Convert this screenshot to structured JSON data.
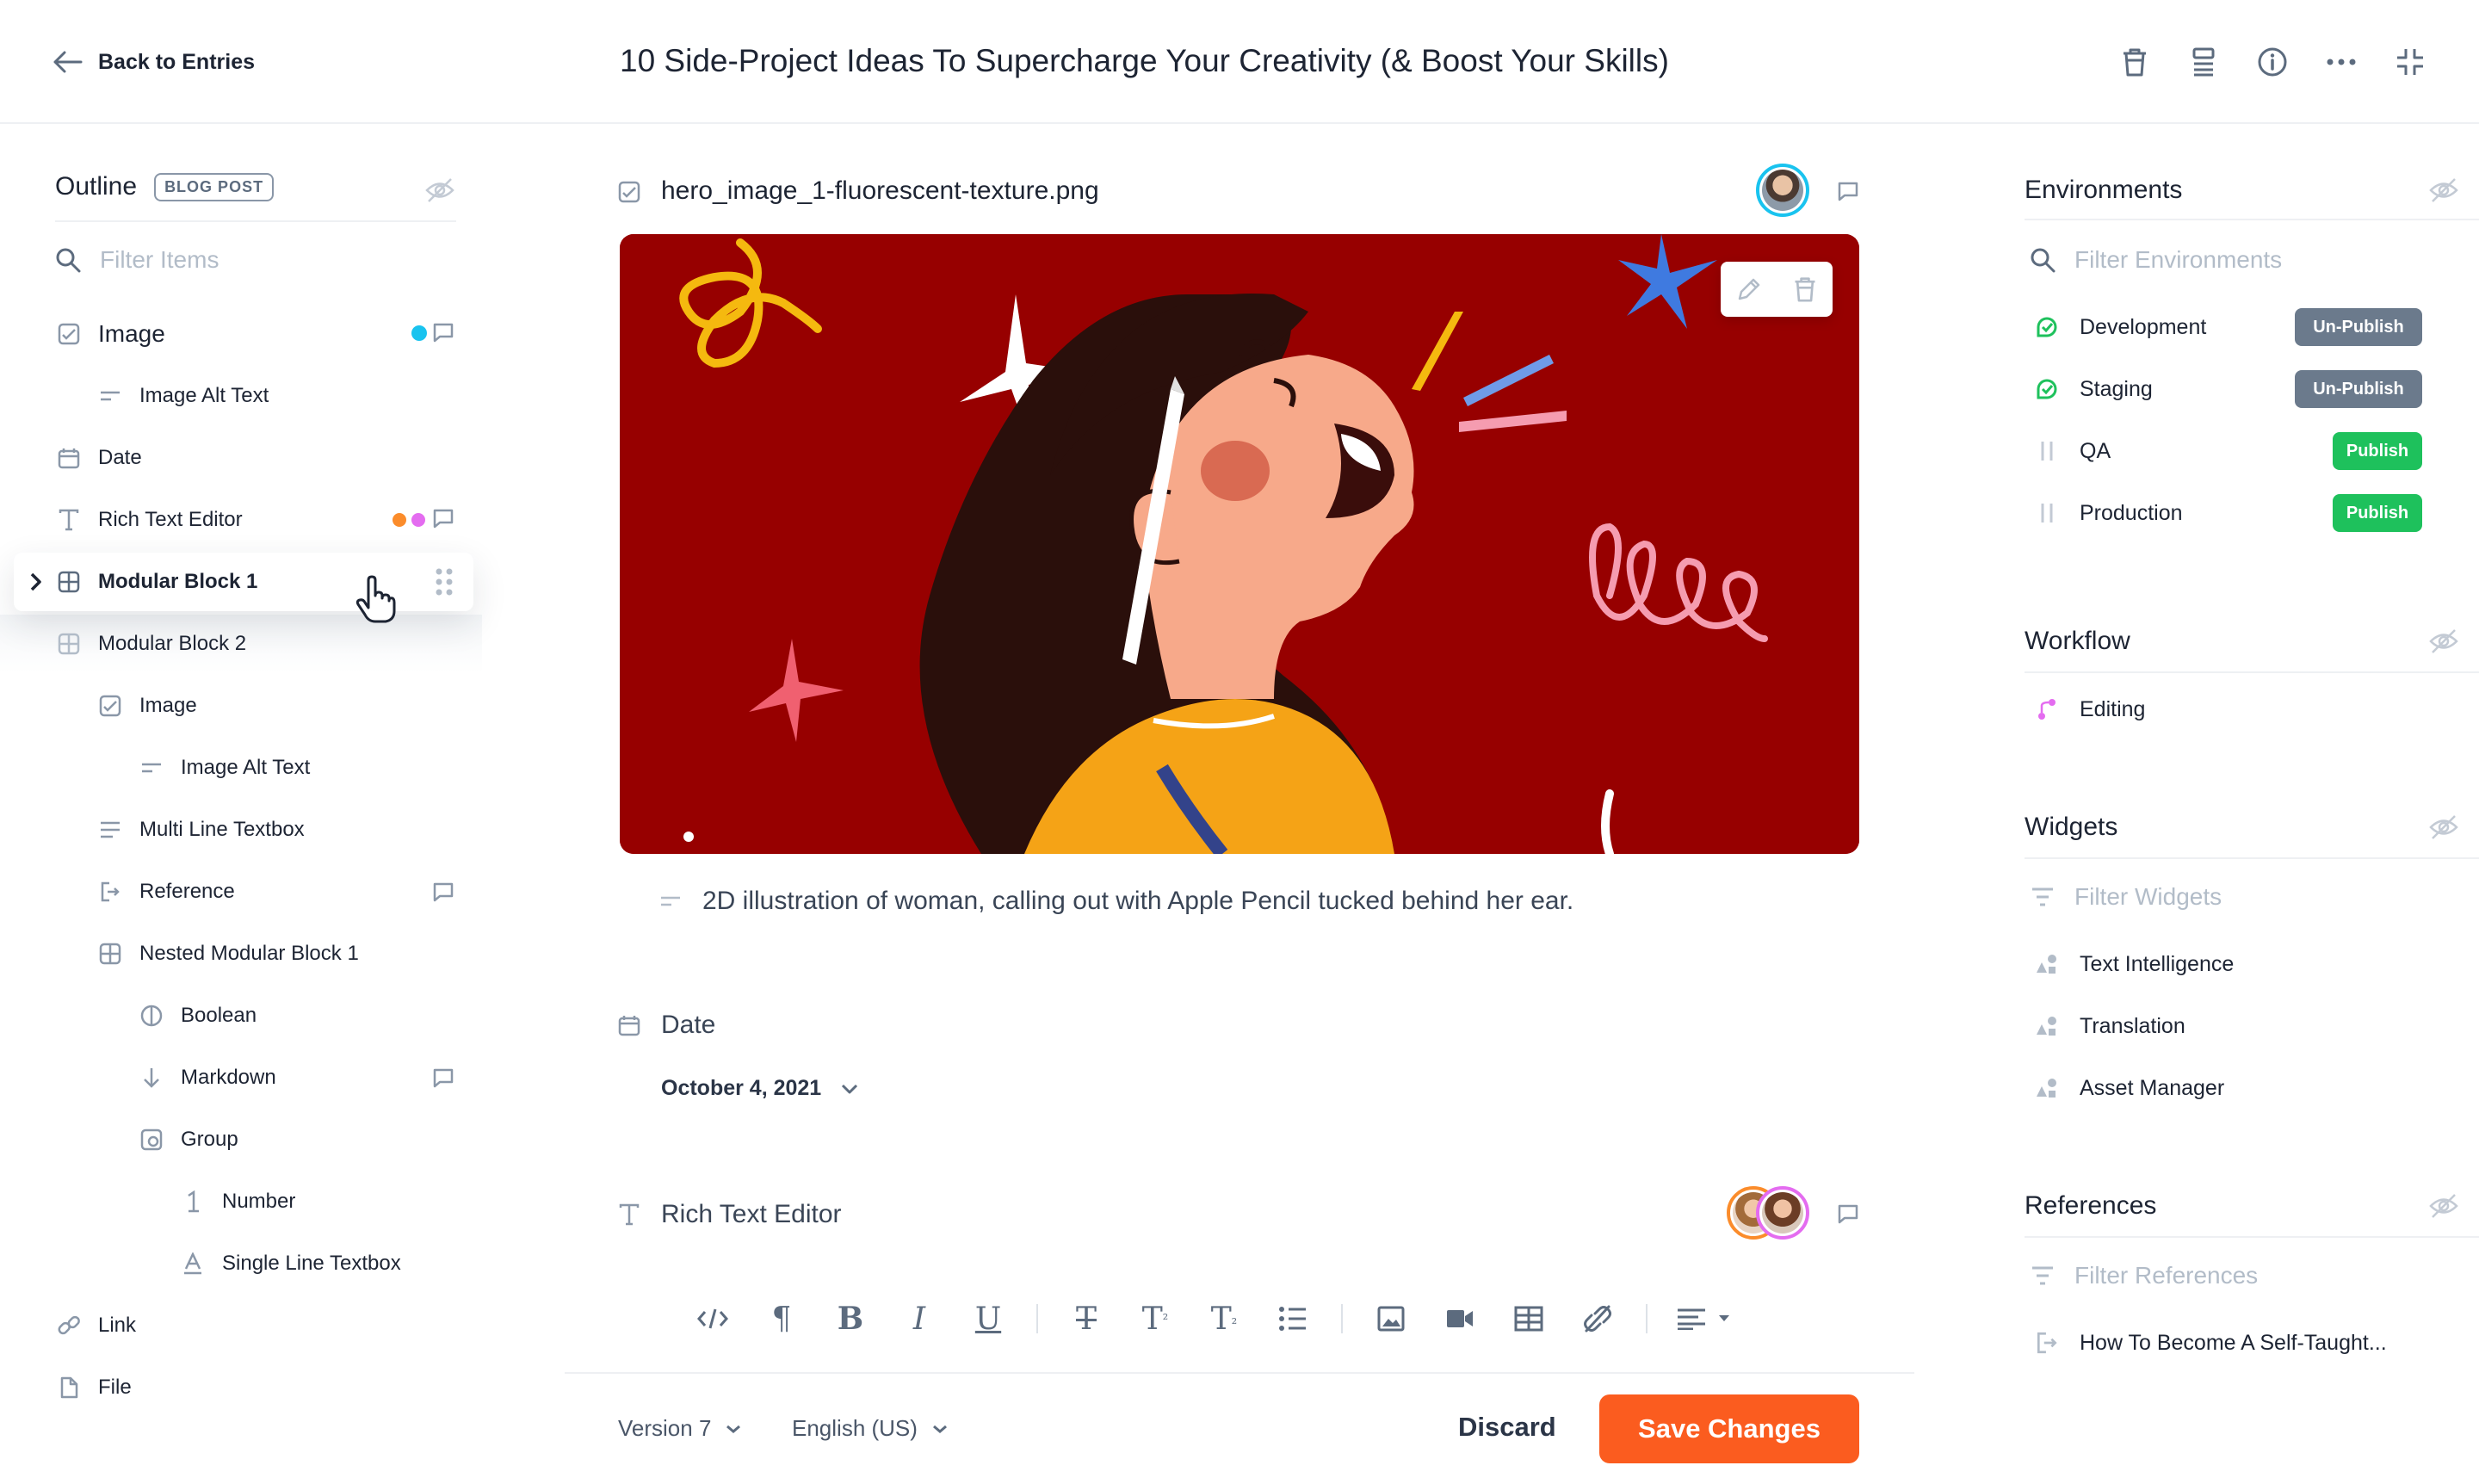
{
  "header": {
    "back_label": "Back to Entries",
    "title": "10 Side-Project Ideas To Supercharge Your Creativity (& Boost Your Skills)",
    "icons": [
      "trash-icon",
      "layout-icon",
      "info-icon",
      "more-icon",
      "collapse-icon"
    ]
  },
  "outline": {
    "title": "Outline",
    "badge": "BLOG POST",
    "filter_placeholder": "Filter Items",
    "items": [
      {
        "label": "Image",
        "icon": "image-icon"
      },
      {
        "label": "Image Alt Text",
        "icon": "short-text-icon"
      },
      {
        "label": "Date",
        "icon": "calendar-icon"
      },
      {
        "label": "Rich Text Editor",
        "icon": "text-icon"
      },
      {
        "label": "Modular Block 1",
        "icon": "grid-icon"
      },
      {
        "label": "Modular Block 2",
        "icon": "grid-icon"
      },
      {
        "label": "Image",
        "icon": "image-icon"
      },
      {
        "label": "Image Alt Text",
        "icon": "short-text-icon"
      },
      {
        "label": "Multi Line Textbox",
        "icon": "multiline-icon"
      },
      {
        "label": "Reference",
        "icon": "reference-icon"
      },
      {
        "label": "Nested Modular Block 1",
        "icon": "grid-icon"
      },
      {
        "label": "Boolean",
        "icon": "boolean-icon"
      },
      {
        "label": "Markdown",
        "icon": "markdown-icon"
      },
      {
        "label": "Group",
        "icon": "group-icon"
      },
      {
        "label": "Number",
        "icon": "number-icon"
      },
      {
        "label": "Single Line Textbox",
        "icon": "single-line-icon"
      },
      {
        "label": "Link",
        "icon": "link-icon"
      },
      {
        "label": "File",
        "icon": "file-icon"
      }
    ],
    "colors": {
      "presence_cyan": "#19c3ef",
      "presence_orange": "#fb8c2b",
      "presence_pink": "#e46cf0"
    }
  },
  "main": {
    "image_field": {
      "file_name": "hero_image_1-fluorescent-texture.png",
      "alt_text": "2D illustration of woman, calling out with Apple Pencil tucked behind her ear."
    },
    "date_field": {
      "label": "Date",
      "value": "October 4, 2021"
    },
    "rich_text_field": {
      "label": "Rich Text Editor",
      "toolbar": [
        "code-icon",
        "paragraph-icon",
        "bold-icon",
        "italic-icon",
        "underline-icon",
        "strikethrough-icon",
        "superscript-icon",
        "subscript-icon",
        "bullet-list-icon",
        "image-icon",
        "video-icon",
        "table-icon",
        "unlink-icon",
        "align-icon"
      ]
    },
    "footer": {
      "version": "Version 7",
      "locale": "English (US)",
      "discard": "Discard",
      "save": "Save Changes"
    },
    "colors": {
      "accent": "#fb5c1f",
      "hero_background": "#970000"
    }
  },
  "right_sidebar": {
    "environments": {
      "title": "Environments",
      "filter_placeholder": "Filter Environments",
      "items": [
        {
          "name": "Development",
          "action": "Un-Publish",
          "status": "published"
        },
        {
          "name": "Staging",
          "action": "Un-Publish",
          "status": "published"
        },
        {
          "name": "QA",
          "action": "Publish",
          "status": "unpublished"
        },
        {
          "name": "Production",
          "action": "Publish",
          "status": "unpublished"
        }
      ]
    },
    "workflow": {
      "title": "Workflow",
      "stage": "Editing"
    },
    "widgets": {
      "title": "Widgets",
      "filter_placeholder": "Filter Widgets",
      "items": [
        "Text Intelligence",
        "Translation",
        "Asset Manager"
      ]
    },
    "references": {
      "title": "References",
      "filter_placeholder": "Filter References",
      "items": [
        "How To Become A Self-Taught..."
      ]
    },
    "colors": {
      "publish_green": "#1ec15c",
      "unpublish_grey": "#6b7a8c",
      "env_green": "#1ec15c"
    }
  }
}
